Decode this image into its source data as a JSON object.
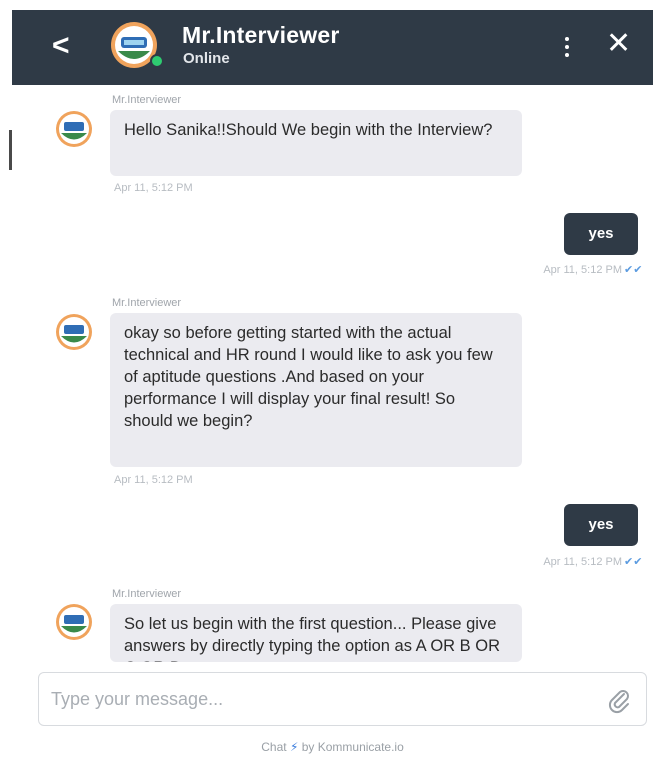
{
  "header": {
    "back_glyph": "<",
    "title": "Mr.Interviewer",
    "status": "Online",
    "menu_icon": "vertical-dots-icon",
    "close_glyph": "✕",
    "status_color": "#2ecc71"
  },
  "messages": [
    {
      "direction": "incoming",
      "sender": "Mr.Interviewer",
      "text": "Hello Sanika!!Should We begin with the Interview?",
      "time": "Apr 11, 5:12 PM"
    },
    {
      "direction": "outgoing",
      "text": "yes",
      "time": "Apr 11, 5:12 PM"
    },
    {
      "direction": "incoming",
      "sender": "Mr.Interviewer",
      "text": "okay so before getting started with the actual technical and HR round I would like to ask you few of aptitude questions .And based on your performance I will display your final result! So should we begin?",
      "time": "Apr 11, 5:12 PM"
    },
    {
      "direction": "outgoing",
      "text": "yes",
      "time": "Apr 11, 5:12 PM"
    },
    {
      "direction": "incoming",
      "sender": "Mr.Interviewer",
      "text": "So let us begin with the first question... Please give answers by directly typing the option  as A OR B OR C OR D"
    }
  ],
  "composer": {
    "placeholder": "Type your message...",
    "attach_icon": "paperclip-icon"
  },
  "footer": {
    "prefix": "Chat",
    "bolt": "⚡",
    "suffix": "by Kommunicate.io"
  },
  "colors": {
    "header_bg": "#2f3a46",
    "incoming_bubble": "#ebebf0",
    "outgoing_bubble": "#2f3a46",
    "read_tick": "#5b9be0"
  }
}
